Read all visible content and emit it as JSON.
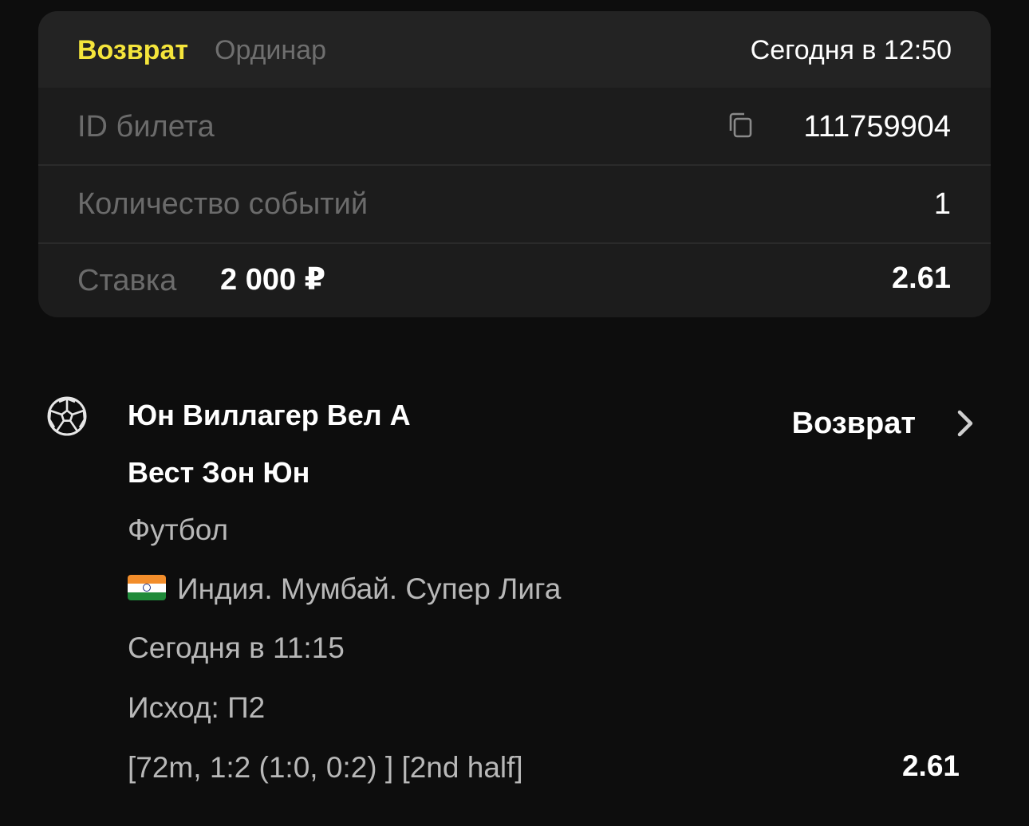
{
  "ticket": {
    "status": "Возврат",
    "bet_type": "Ординар",
    "date": "Сегодня в 12:50",
    "rows": {
      "id_label": "ID билета",
      "id_value": "111759904",
      "events_label": "Количество событий",
      "events_value": "1",
      "stake_label": "Ставка",
      "stake_amount": "2 000 ₽",
      "odds": "2.61"
    }
  },
  "event": {
    "team1": "Юн Виллагер Вел А",
    "team2": "Вест Зон Юн",
    "sport": "Футбол",
    "league": "Индия. Мумбай. Супер Лига",
    "time": "Сегодня в 11:15",
    "outcome": "Исход: П2",
    "score": "[72m, 1:2 (1:0, 0:2) ] [2nd half]",
    "status": "Возврат",
    "odds": "2.61",
    "icons": {
      "sport": "soccer-ball-icon",
      "flag": "india-flag-icon",
      "details": "chevron-right-icon",
      "copy": "copy-icon"
    }
  },
  "colors": {
    "background": "#0d0d0d",
    "card": "#1c1c1c",
    "accent_status": "#f5e53b"
  }
}
